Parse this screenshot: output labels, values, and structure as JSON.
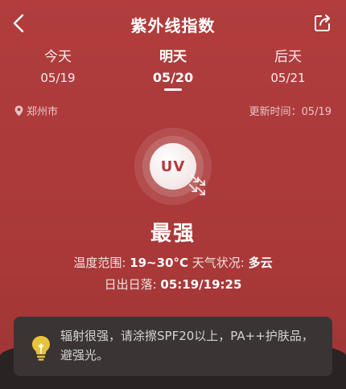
{
  "header": {
    "title": "紫外线指数"
  },
  "tabs": [
    {
      "name": "今天",
      "date": "05/19"
    },
    {
      "name": "明天",
      "date": "05/20"
    },
    {
      "name": "后天",
      "date": "05/21"
    }
  ],
  "info": {
    "location": "郑州市",
    "update_label": "更新时间：05/19"
  },
  "uv": {
    "badge": "UV",
    "level": "最强"
  },
  "details": {
    "temp_label": "温度范围: ",
    "temp_value": "19~30°C",
    "weather_label": " 天气状况: ",
    "weather_value": "多云",
    "sun_label": "日出日落: ",
    "sun_value": "05:19/19:25"
  },
  "tip": {
    "text": "辐射很强，请涂擦SPF20以上，PA++护肤品，避强光。"
  },
  "colors": {
    "background": "#ad3a3a",
    "card": "#3a3434",
    "bulb": "#e7c23a"
  }
}
